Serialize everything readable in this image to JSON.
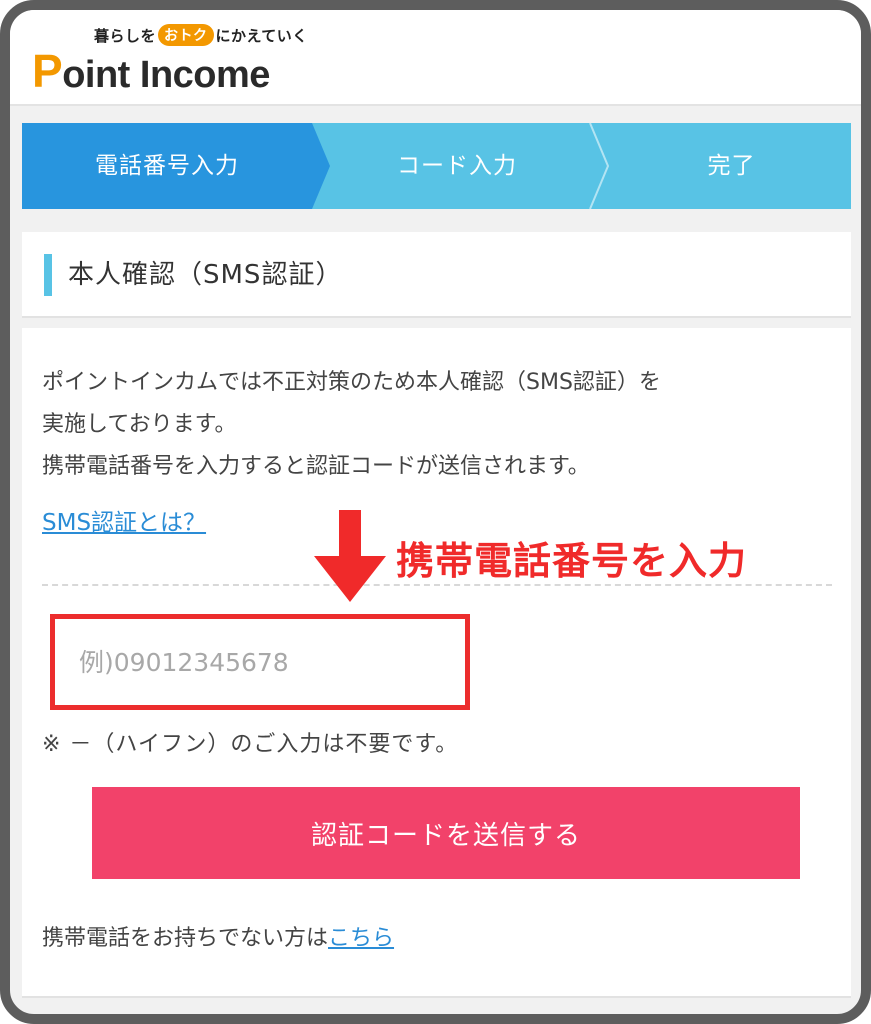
{
  "header": {
    "tagline_pre": "暮らしを",
    "tagline_badge": "おトク",
    "tagline_post": "にかえていく",
    "brand_first": "P",
    "brand_rest": "oint Income"
  },
  "stepper": {
    "steps": [
      {
        "label": "電話番号入力",
        "active": true
      },
      {
        "label": "コード入力",
        "active": false
      },
      {
        "label": "完了",
        "active": false
      }
    ]
  },
  "section": {
    "title": "本人確認（SMS認証）"
  },
  "main": {
    "desc_line1": "ポイントインカムでは不正対策のため本人確認（SMS認証）を",
    "desc_line2": "実施しております。",
    "desc_line3": "携帯電話番号を入力すると認証コードが送信されます。",
    "sms_link": "SMS認証とは？",
    "annotation": "携帯電話番号を入力",
    "phone_placeholder": "例)09012345678",
    "note": "※ －（ハイフン）のご入力は不要です。",
    "send_button": "認証コードを送信する",
    "footer_text": "携帯電話をお持ちでない方は",
    "footer_link": "こちら"
  },
  "colors": {
    "accent_blue": "#58c3e5",
    "active_step_blue": "#2895de",
    "button_pink": "#f2426a",
    "annotation_red": "#f02a2a",
    "logo_orange": "#f39800",
    "link_blue": "#2a8cd6"
  },
  "icons": {
    "annotation_arrow": "arrow-down-icon"
  }
}
